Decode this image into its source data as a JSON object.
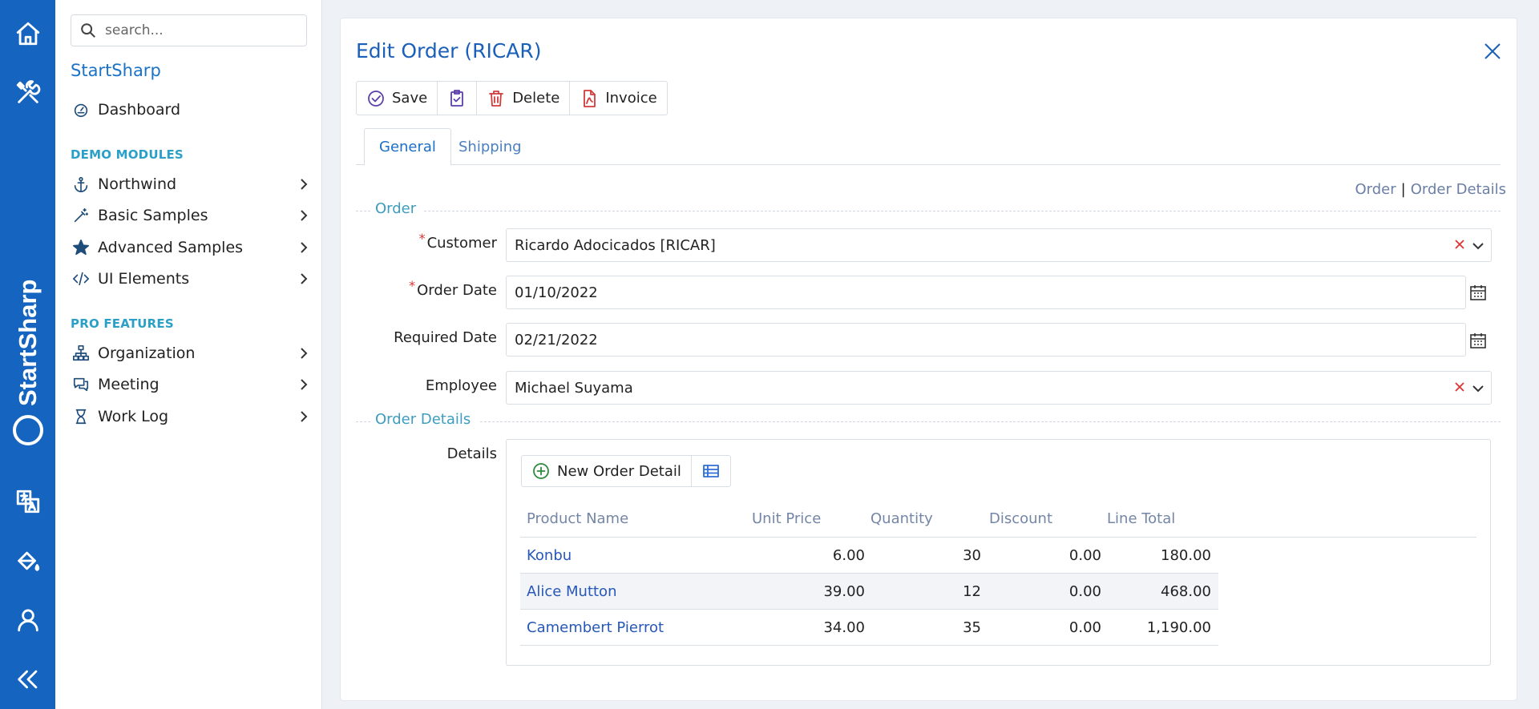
{
  "rail": {
    "brand_vertical": "StartSharp",
    "icons": [
      "home-icon",
      "tools-icon",
      "translate-icon",
      "paint-bucket-icon",
      "user-icon",
      "collapse-icon"
    ]
  },
  "sidebar": {
    "search_placeholder": "search...",
    "app_name": "StartSharp",
    "dashboard": "Dashboard",
    "demo_header": "DEMO MODULES",
    "demo_items": [
      {
        "label": "Northwind",
        "icon": "anchor-icon"
      },
      {
        "label": "Basic Samples",
        "icon": "magic-wand-icon"
      },
      {
        "label": "Advanced Samples",
        "icon": "star-icon"
      },
      {
        "label": "UI Elements",
        "icon": "code-icon"
      }
    ],
    "pro_header": "PRO FEATURES",
    "pro_items": [
      {
        "label": "Organization",
        "icon": "org-chart-icon"
      },
      {
        "label": "Meeting",
        "icon": "chat-icon"
      },
      {
        "label": "Work Log",
        "icon": "hourglass-icon"
      }
    ]
  },
  "dialog": {
    "title": "Edit Order (RICAR)",
    "toolbar": {
      "save": "Save",
      "delete": "Delete",
      "invoice": "Invoice"
    },
    "tabs": [
      "General",
      "Shipping"
    ],
    "crumbs": {
      "order": "Order",
      "sep": "|",
      "details": "Order Details"
    },
    "category_order": "Order",
    "category_details": "Order Details",
    "fields": {
      "customer_label": "Customer",
      "customer_value": "Ricardo Adocicados [RICAR]",
      "order_date_label": "Order Date",
      "order_date_value": "01/10/2022",
      "required_date_label": "Required Date",
      "required_date_value": "02/21/2022",
      "employee_label": "Employee",
      "employee_value": "Michael Suyama",
      "details_label": "Details",
      "required_marker": "*"
    },
    "details_toolbar": {
      "new": "New Order Detail"
    },
    "grid": {
      "headers": [
        "Product Name",
        "Unit Price",
        "Quantity",
        "Discount",
        "Line Total"
      ],
      "rows": [
        [
          "Konbu",
          "6.00",
          "30",
          "0.00",
          "180.00"
        ],
        [
          "Alice Mutton",
          "39.00",
          "12",
          "0.00",
          "468.00"
        ],
        [
          "Camembert Pierrot",
          "34.00",
          "35",
          "0.00",
          "1,190.00"
        ]
      ]
    }
  },
  "colors": {
    "rail": "#1565c0",
    "accent": "#1a5fb8",
    "section": "#3d9cbf",
    "link": "#2757b8"
  }
}
